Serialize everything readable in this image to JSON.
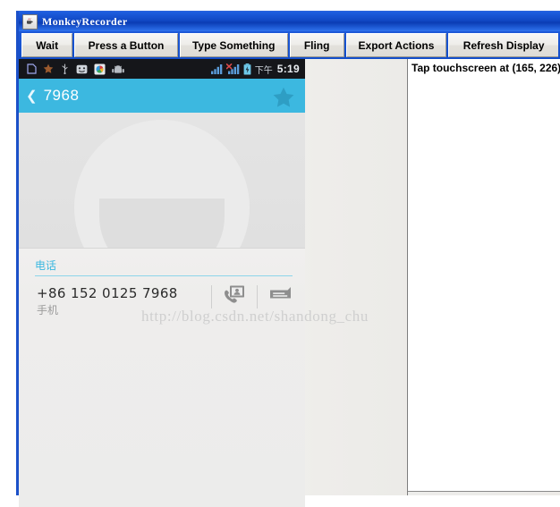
{
  "window": {
    "title": "MonkeyRecorder",
    "app_icon": "java-coffee-cup-icon"
  },
  "toolbar": {
    "buttons": [
      {
        "label": "Wait",
        "name": "wait-button"
      },
      {
        "label": "Press a Button",
        "name": "press-a-button-button"
      },
      {
        "label": "Type Something",
        "name": "type-something-button"
      },
      {
        "label": "Fling",
        "name": "fling-button"
      },
      {
        "label": "Export Actions",
        "name": "export-actions-button"
      },
      {
        "label": "Refresh Display",
        "name": "refresh-display-button"
      }
    ]
  },
  "actions_log": {
    "lines": [
      "Tap touchscreen at (165, 226)"
    ]
  },
  "device": {
    "status_bar": {
      "left_icons": [
        "sim-card-icon",
        "star-icon",
        "usb-icon",
        "smiley-face-icon",
        "photos-app-icon",
        "android-robot-icon"
      ],
      "signal_icon": "signal-bars-icon",
      "signal2_icon": "signal-bars-no-service-icon",
      "battery_icon": "battery-charging-icon",
      "am_pm": "下午",
      "time": "5:19"
    },
    "action_bar": {
      "back_glyph": "❮",
      "title": "7968",
      "star_icon": "star-favorite-icon"
    },
    "avatar": {
      "icon": "default-contact-avatar-icon"
    },
    "phone_section": {
      "label": "电话",
      "number": "+86 152 0125 7968",
      "type": "手机",
      "call_icon": "call-contact-icon",
      "message_icon": "send-message-icon"
    }
  },
  "watermark": {
    "text": "http://blog.csdn.net/shandong_chu"
  },
  "colors": {
    "titlebar_blue": "#1148c4",
    "android_accent": "#3cb8e0",
    "status_bar_dark": "#15161a",
    "panel_gray": "#eceae7"
  }
}
